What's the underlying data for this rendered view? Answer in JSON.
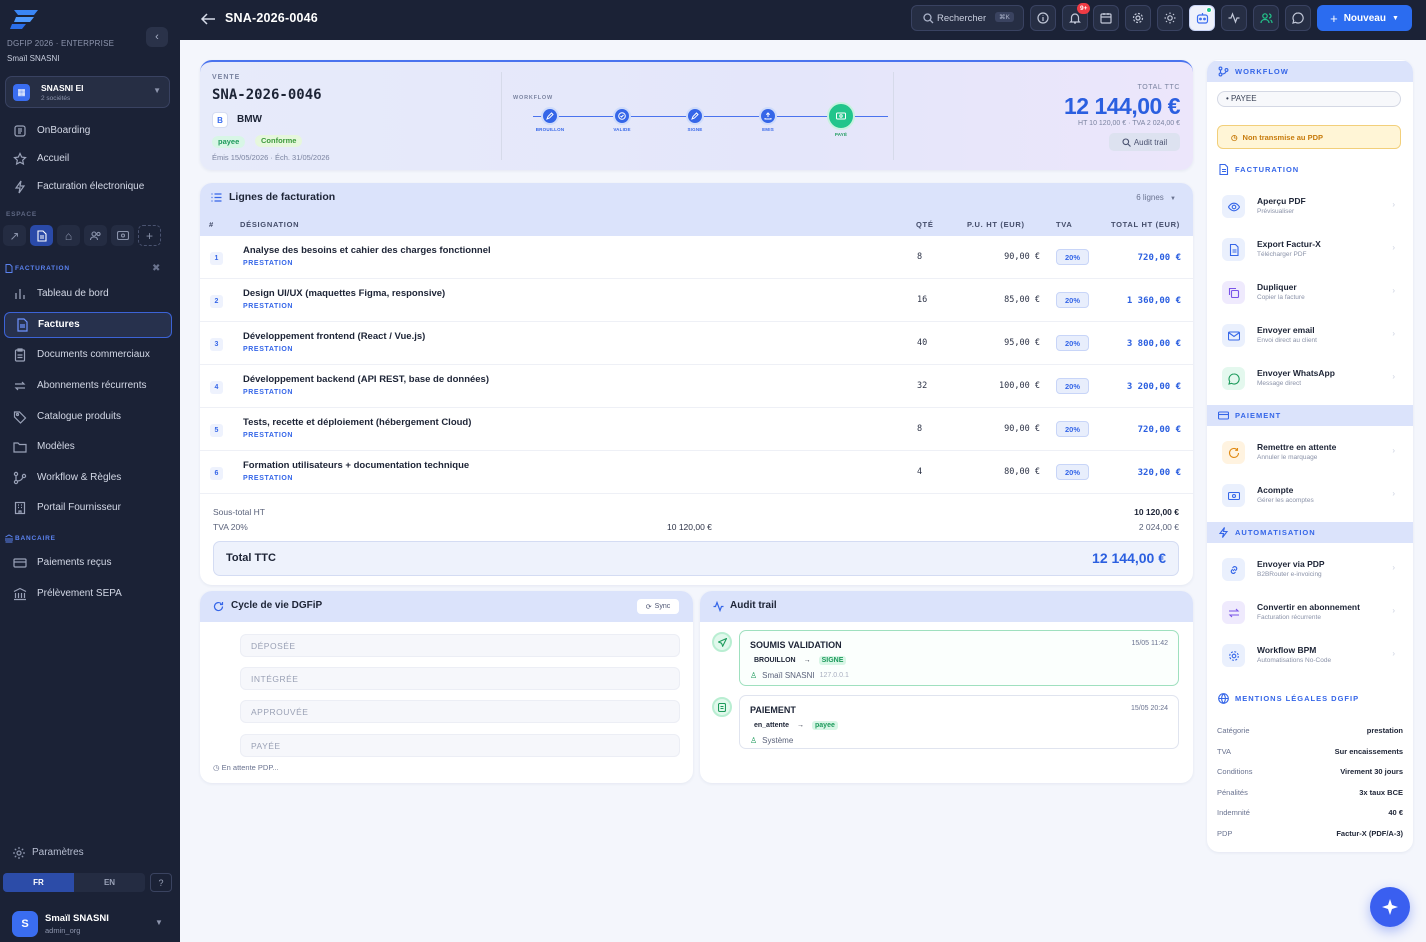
{
  "sidebar": {
    "org": "DGFIP 2026 · ENTERPRISE",
    "org_user": "Smaïl SNASNI",
    "company": {
      "name": "SNASNI EI",
      "sub": "2 sociétés"
    },
    "top_nav": [
      "OnBoarding",
      "Accueil",
      "Facturation électronique"
    ],
    "espace_label": "ESPACE",
    "facturation_label": "FACTURATION",
    "fact_nav": [
      "Tableau de bord",
      "Factures",
      "Documents commerciaux",
      "Abonnements récurrents",
      "Catalogue produits",
      "Modèles",
      "Workflow & Règles",
      "Portail Fournisseur"
    ],
    "bancaire_label": "BANCAIRE",
    "bank_nav": [
      "Paiements reçus",
      "Prélèvement SEPA"
    ],
    "settings": "Paramètres",
    "lang": [
      "FR",
      "EN"
    ],
    "help": "?",
    "user": {
      "initial": "S",
      "name": "Smaïl SNASNI",
      "role": "admin_org"
    }
  },
  "topbar": {
    "title": "SNA-2026-0046",
    "search": "Rechercher",
    "shortcut": "⌘K",
    "notif_count": "9+",
    "new_label": "Nouveau"
  },
  "invoice": {
    "kicker": "VENTE",
    "number": "SNA-2026-0046",
    "client_initial": "B",
    "client": "BMW",
    "status": "payee",
    "conformity": "Conforme",
    "dates": "Émis 15/05/2026 · Éch. 31/05/2026",
    "workflow_label": "WORKFLOW",
    "workflow": [
      "BROUILLON",
      "VALIDE",
      "SIGNE",
      "EMIS",
      "PAYÉ"
    ],
    "total_label": "TOTAL TTC",
    "total": "12 144,00 €",
    "total_sub": "HT 10 120,00 € · TVA 2 024,00 €",
    "audit_btn": "Audit trail"
  },
  "lines": {
    "title": "Lignes de facturation",
    "count": "6 lignes",
    "headers": {
      "num": "#",
      "designation": "DÉSIGNATION",
      "qty": "QTÉ",
      "pu": "P.U. HT (EUR)",
      "tva": "TVA",
      "total": "TOTAL HT (EUR)"
    },
    "rows": [
      {
        "n": "1",
        "d": "Analyse des besoins et cahier des charges fonctionnel",
        "k": "PRESTATION",
        "q": "8",
        "pu": "90,00 €",
        "tva": "20%",
        "t": "720,00 €"
      },
      {
        "n": "2",
        "d": "Design UI/UX (maquettes Figma, responsive)",
        "k": "PRESTATION",
        "q": "16",
        "pu": "85,00 €",
        "tva": "20%",
        "t": "1 360,00 €"
      },
      {
        "n": "3",
        "d": "Développement frontend (React / Vue.js)",
        "k": "PRESTATION",
        "q": "40",
        "pu": "95,00 €",
        "tva": "20%",
        "t": "3 800,00 €"
      },
      {
        "n": "4",
        "d": "Développement backend (API REST, base de données)",
        "k": "PRESTATION",
        "q": "32",
        "pu": "100,00 €",
        "tva": "20%",
        "t": "3 200,00 €"
      },
      {
        "n": "5",
        "d": "Tests, recette et déploiement (hébergement Cloud)",
        "k": "PRESTATION",
        "q": "8",
        "pu": "90,00 €",
        "tva": "20%",
        "t": "720,00 €"
      },
      {
        "n": "6",
        "d": "Formation utilisateurs + documentation technique",
        "k": "PRESTATION",
        "q": "4",
        "pu": "80,00 €",
        "tva": "20%",
        "t": "320,00 €"
      }
    ],
    "subtotal_label": "Sous-total HT",
    "subtotal": "10 120,00 €",
    "tva_label": "TVA 20%",
    "tva_base": "10 120,00 €",
    "tva_value": "2 024,00 €",
    "ttc_label": "Total TTC",
    "ttc": "12 144,00 €"
  },
  "cycle": {
    "title": "Cycle de vie DGFiP",
    "sync": "Sync",
    "steps": [
      "DÉPOSÉE",
      "INTÉGRÉE",
      "APPROUVÉE",
      "PAYÉE"
    ],
    "footer": "En attente PDP..."
  },
  "audit": {
    "title": "Audit trail",
    "entries": [
      {
        "title": "SOUMIS VALIDATION",
        "date": "15/05 11:42",
        "from": "BROUILLON",
        "to": "SIGNE",
        "user": "Smaïl SNASNI",
        "ip": "127.0.0.1"
      },
      {
        "title": "PAIEMENT",
        "date": "15/05 20:24",
        "from": "en_attente",
        "to": "payee",
        "user": "Système"
      }
    ]
  },
  "right": {
    "workflow": "WORKFLOW",
    "status": "PAYEE",
    "warning": "Non transmise au PDP",
    "facturation": "FACTURATION",
    "fact_actions": [
      {
        "t": "Aperçu PDF",
        "s": "Prévisualiser"
      },
      {
        "t": "Export Factur-X",
        "s": "Télécharger PDF"
      },
      {
        "t": "Dupliquer",
        "s": "Copier la facture"
      },
      {
        "t": "Envoyer email",
        "s": "Envoi direct au client"
      },
      {
        "t": "Envoyer WhatsApp",
        "s": "Message direct"
      }
    ],
    "paiement": "PAIEMENT",
    "pay_actions": [
      {
        "t": "Remettre en attente",
        "s": "Annuler le marquage"
      },
      {
        "t": "Acompte",
        "s": "Gérer les acomptes"
      }
    ],
    "automatisation": "AUTOMATISATION",
    "auto_actions": [
      {
        "t": "Envoyer via PDP",
        "s": "B2BRouter e-invoicing"
      },
      {
        "t": "Convertir en abonnement",
        "s": "Facturation récurrente"
      },
      {
        "t": "Workflow BPM",
        "s": "Automatisations No-Code"
      }
    ],
    "mentions": "MENTIONS LÉGALES DGFIP",
    "legal": [
      {
        "k": "Catégorie",
        "v": "prestation"
      },
      {
        "k": "TVA",
        "v": "Sur encaissements"
      },
      {
        "k": "Conditions",
        "v": "Virement 30 jours"
      },
      {
        "k": "Pénalités",
        "v": "3x taux BCE"
      },
      {
        "k": "Indemnité",
        "v": "40 €"
      },
      {
        "k": "PDP",
        "v": "Factur-X (PDF/A-3)"
      }
    ]
  }
}
